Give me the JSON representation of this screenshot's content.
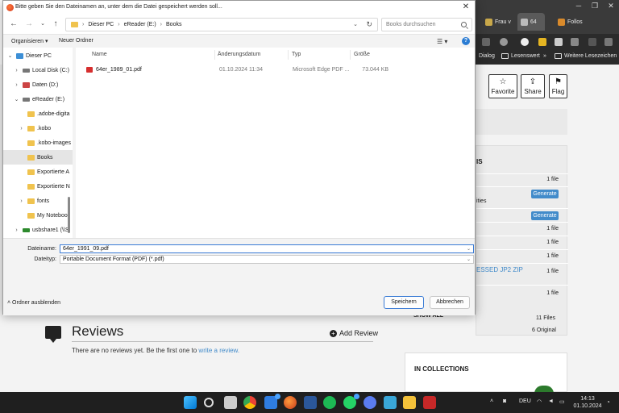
{
  "browser": {
    "tabs": [
      {
        "label": "Frau v"
      },
      {
        "label": "64"
      },
      {
        "label": "Follos"
      }
    ],
    "bookmarks": [
      {
        "label": "Dialog"
      },
      {
        "label": "Lesenswert"
      },
      {
        "label": "Weitere Lesezeichen"
      }
    ]
  },
  "page": {
    "actions": [
      {
        "label": "Favorite",
        "icon": "☆"
      },
      {
        "label": "Share",
        "icon": "⇪"
      },
      {
        "label": "Flag",
        "icon": "⚑"
      }
    ],
    "panel_title": "IS",
    "rows": [
      {
        "value": "1 file"
      },
      {
        "value": "Generate",
        "prefix": "ities"
      },
      {
        "value": "Generate"
      },
      {
        "value": "1 file"
      },
      {
        "value": "1 file"
      },
      {
        "value": "1 file"
      },
      {
        "value": "1 file",
        "link": "ESSED JP2 ZIP"
      },
      {
        "value": "1 file"
      }
    ],
    "show_all": "SHOW ALL",
    "files_count": "11 Files",
    "original_count": "6 Original",
    "reviews_title": "Reviews",
    "add_review": "Add Review",
    "no_reviews_text": "There are no reviews yet. Be the first one to ",
    "no_reviews_link": "write a review.",
    "collections_title": "IN COLLECTIONS"
  },
  "dialog": {
    "title": "Bitte geben Sie den Dateinamen an, unter dem die Datei gespeichert werden soll...",
    "breadcrumb": [
      "Dieser PC",
      "eReader (E:)",
      "Books"
    ],
    "search_placeholder": "Books durchsuchen",
    "organize": "Organisieren",
    "new_folder": "Neuer Ordner",
    "tree": [
      {
        "label": "Dieser PC",
        "icon": "pc",
        "chev": "⌄",
        "indent": 0
      },
      {
        "label": "Local Disk (C:)",
        "icon": "disk",
        "chev": "›",
        "indent": 1
      },
      {
        "label": "Daten (D:)",
        "icon": "media",
        "chev": "›",
        "indent": 1
      },
      {
        "label": "eReader (E:)",
        "icon": "disk",
        "chev": "⌄",
        "indent": 1
      },
      {
        "label": ".adobe-digita",
        "icon": "folder",
        "chev": "",
        "indent": 2
      },
      {
        "label": ".kobo",
        "icon": "folder",
        "chev": "›",
        "indent": 2
      },
      {
        "label": ".kobo-images",
        "icon": "folder",
        "chev": "",
        "indent": 2
      },
      {
        "label": "Books",
        "icon": "folder",
        "chev": "",
        "indent": 2,
        "selected": true
      },
      {
        "label": "Exportierte A",
        "icon": "folder",
        "chev": "",
        "indent": 2
      },
      {
        "label": "Exportierte N",
        "icon": "folder",
        "chev": "",
        "indent": 2
      },
      {
        "label": "fonts",
        "icon": "folder",
        "chev": "›",
        "indent": 2
      },
      {
        "label": "My Notebool",
        "icon": "folder",
        "chev": "",
        "indent": 2
      },
      {
        "label": "usbshare1 (\\\\S",
        "icon": "net",
        "chev": "›",
        "indent": 1
      }
    ],
    "columns": {
      "name": "Name",
      "date": "Änderungsdatum",
      "type": "Typ",
      "size": "Größe"
    },
    "files": [
      {
        "name": "64er_1989_01.pdf",
        "date": "01.10.2024 11:34",
        "type": "Microsoft Edge PDF ...",
        "size": "73.044 KB"
      }
    ],
    "filename_label": "Dateiname:",
    "filename_value": "64er_1991_09.pdf",
    "filetype_label": "Dateityp:",
    "filetype_value": "Portable Document Format (PDF) (*.pdf)",
    "hide_folders": "Ordner ausblenden",
    "save": "Speichern",
    "cancel": "Abbrechen"
  },
  "taskbar": {
    "language": "DEU",
    "time": "14:13",
    "date": "01.10.2024"
  }
}
